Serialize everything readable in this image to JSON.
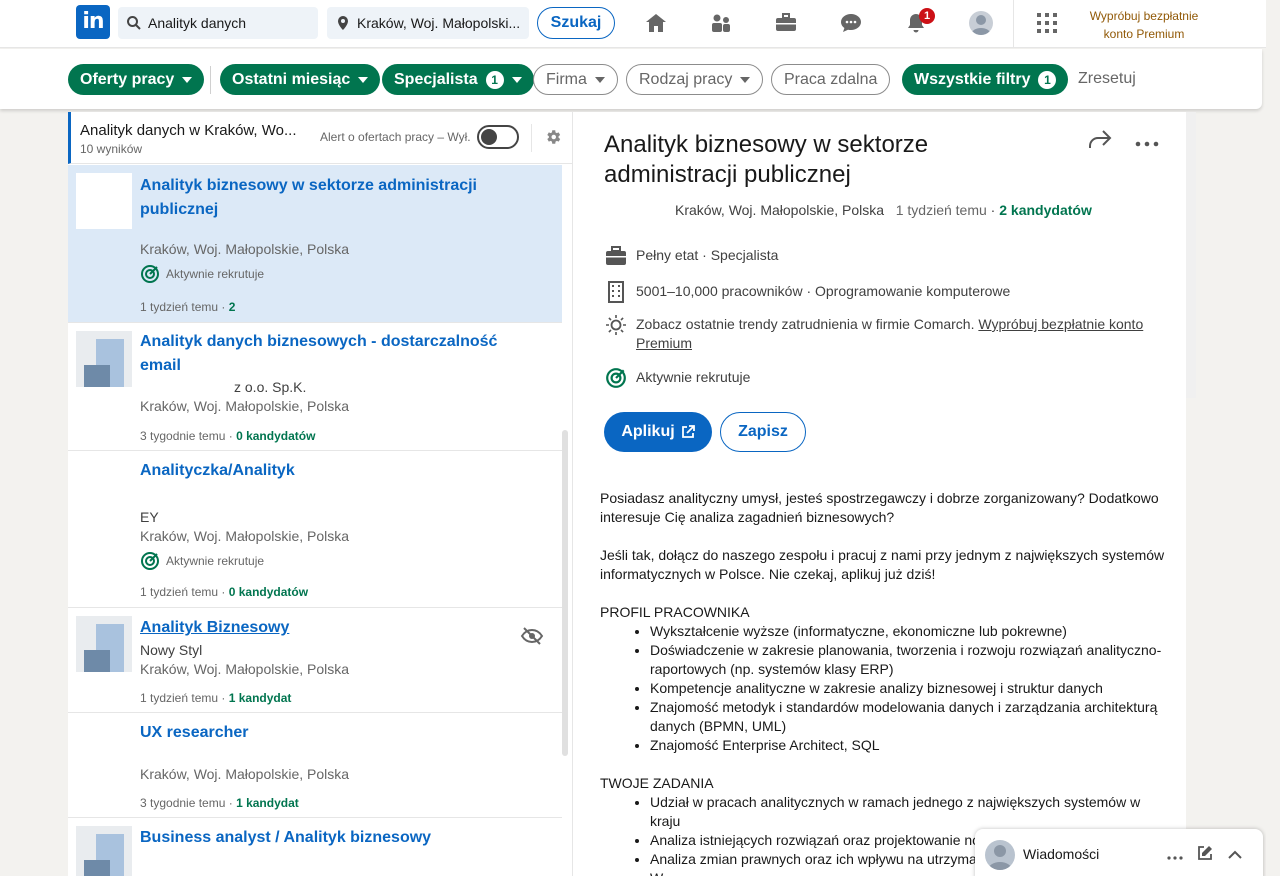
{
  "nav": {
    "logo_text": "in",
    "search_value": "Analityk danych",
    "location_value": "Kraków, Woj. Małopolski...",
    "search_button": "Szukaj",
    "notifications_count": "1",
    "premium_text": "Wypróbuj bezpłatnie konto Premium"
  },
  "filters": {
    "items": [
      {
        "label": "Oferty pracy",
        "active": true
      },
      {
        "label": "Ostatni miesiąc",
        "active": true
      },
      {
        "label": "Specjalista",
        "active": true,
        "count": "1"
      },
      {
        "label": "Firma",
        "active": false
      },
      {
        "label": "Rodzaj pracy",
        "active": false
      },
      {
        "label": "Praca zdalna",
        "active": false
      },
      {
        "label": "Wszystkie filtry",
        "active": true,
        "count": "1"
      }
    ],
    "reset": "Zresetuj"
  },
  "list": {
    "title": "Analityk danych w Kraków, Wo...",
    "count": "10 wyników",
    "alert_label": "Alert o ofertach pracy – Wył."
  },
  "jobs": [
    {
      "title_line1": "Analityk biznesowy w sektorze administracji",
      "title_line2": "publicznej",
      "company": "",
      "location": "Kraków, Woj. Małopolskie, Polska",
      "active": "Aktywnie rekrutuje",
      "time": "1 tydzień temu",
      "candidates": "2"
    },
    {
      "title_line1": "Analityk danych biznesowych - dostarczalność",
      "title_line2": "email",
      "company": "z o.o. Sp.K.",
      "location": "Kraków, Woj. Małopolskie, Polska",
      "time": "3 tygodnie temu",
      "candidates": "0 kandydatów"
    },
    {
      "title_line1": "Analityczka/Analityk",
      "company": "EY",
      "location": "Kraków, Woj. Małopolskie, Polska",
      "active": "Aktywnie rekrutuje",
      "time": "1 tydzień temu",
      "candidates": "0 kandydatów"
    },
    {
      "title_line1": "Analityk Biznesowy",
      "company": "Nowy Styl",
      "location": "Kraków, Woj. Małopolskie, Polska",
      "time": "1 tydzień temu",
      "candidates": "1 kandydat"
    },
    {
      "title_line1": "UX researcher",
      "company": "",
      "location": "Kraków, Woj. Małopolskie, Polska",
      "time": "3 tygodnie temu",
      "candidates": "1 kandydat"
    },
    {
      "title_line1": "Business analyst / Analityk biznesowy",
      "company": "",
      "location": "",
      "time": "",
      "candidates": ""
    }
  ],
  "detail": {
    "title": "Analityk biznesowy w sektorze administracji publicznej",
    "location": "Kraków, Woj. Małopolskie, Polska",
    "posted": "1 tydzień temu",
    "candidates": "2 kandydatów",
    "employment": "Pełny etat · Specjalista",
    "company_size": "5001–10,000 pracowników · Oprogramowanie komputerowe",
    "trends_text": "Zobacz ostatnie trendy zatrudnienia w firmie Comarch.",
    "trends_link": "Wypróbuj bezpłatnie konto Premium",
    "active": "Aktywnie rekrutuje",
    "apply": "Aplikuj",
    "save": "Zapisz",
    "para1": "Posiadasz analityczny umysł, jesteś spostrzegawczy i dobrze zorganizowany? Dodatkowo interesuje Cię analiza zagadnień biznesowych?",
    "para2": "Jeśli tak, dołącz do naszego zespołu i pracuj z nami przy jednym z największych systemów informatycznych w Polsce. Nie czekaj, aplikuj już dziś!",
    "section1": "PROFIL PRACOWNIKA",
    "bullets1": [
      "Wykształcenie wyższe (informatyczne, ekonomiczne lub pokrewne)",
      "Doświadczenie w zakresie planowania, tworzenia i rozwoju rozwiązań analityczno-raportowych (np. systemów klasy ERP)",
      "Kompetencje analityczne w zakresie analizy biznesowej i struktur danych",
      "Znajomość metodyk i standardów modelowania danych i zarządzania architekturą danych (BPMN, UML)",
      "Znajomość Enterprise Architect, SQL"
    ],
    "section2": "TWOJE ZADANIA",
    "bullets2": [
      "Udział w pracach analitycznych w ramach jednego z największych systemów w kraju",
      "Analiza istniejących rozwiązań oraz projektowanie no",
      "Analiza zmian prawnych oraz ich wpływu na utrzymai",
      "W"
    ]
  },
  "messaging": {
    "label": "Wiadomości"
  },
  "colors": {
    "brand": "#0a66c2",
    "green": "#01754f",
    "premium": "#915907"
  }
}
